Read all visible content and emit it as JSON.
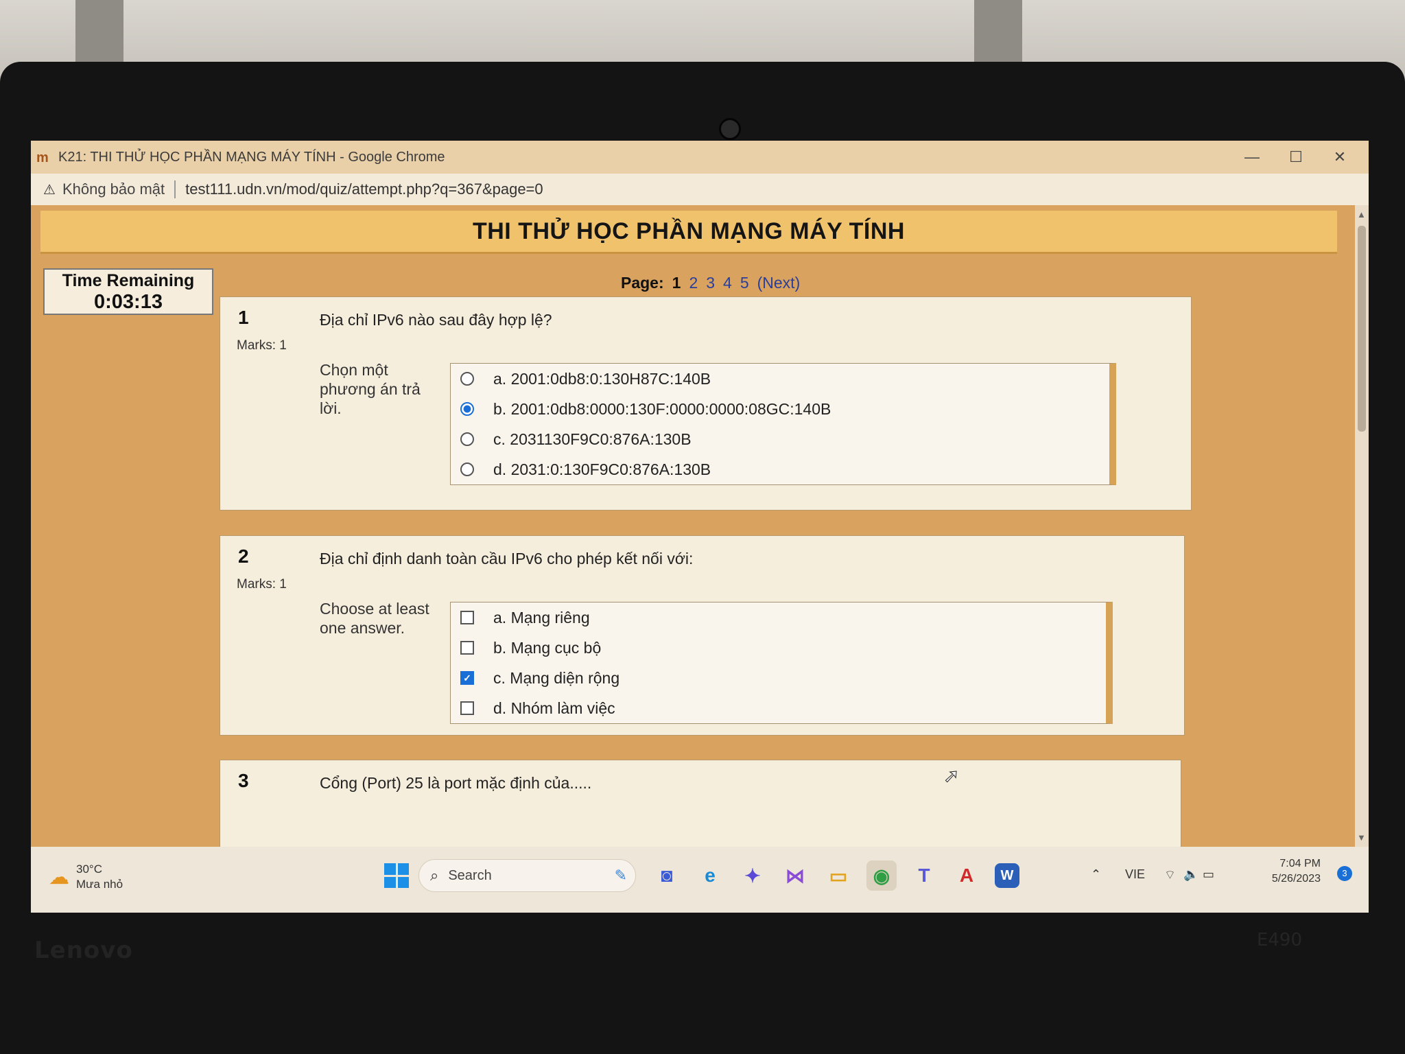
{
  "window": {
    "title": "K21: THI THỬ HỌC PHẦN MẠNG MÁY TÍNH - Google Chrome",
    "controls": {
      "minimize": "—",
      "maximize": "☐",
      "close": "✕"
    }
  },
  "address_bar": {
    "security_label": "Không bảo mật",
    "url": "test111.udn.vn/mod/quiz/attempt.php?q=367&page=0"
  },
  "page": {
    "title": "THI THỬ HỌC PHẦN MẠNG MÁY TÍNH",
    "timer": {
      "label": "Time Remaining",
      "value": "0:03:13"
    },
    "pagination": {
      "label": "Page:",
      "current": "1",
      "pages": [
        "2",
        "3",
        "4",
        "5"
      ],
      "next_label": "(Next)"
    }
  },
  "questions": [
    {
      "number": "1",
      "marks": "Marks: 1",
      "text": "Địa chỉ IPv6 nào sau đây hợp lệ?",
      "prompt": "Chọn một phương án trả lời.",
      "type": "radio",
      "answers": [
        {
          "label": "a. 2001:0db8:0:130H87C:140B",
          "selected": false
        },
        {
          "label": "b. 2001:0db8:0000:130F:0000:0000:08GC:140B",
          "selected": true
        },
        {
          "label": "c. 2031130F9C0:876A:130B",
          "selected": false
        },
        {
          "label": "d. 2031:0:130F9C0:876A:130B",
          "selected": false
        }
      ]
    },
    {
      "number": "2",
      "marks": "Marks: 1",
      "text": "Địa chỉ định danh toàn cầu IPv6 cho phép kết nối với:",
      "prompt": "Choose at least one answer.",
      "type": "checkbox",
      "answers": [
        {
          "label": "a. Mạng riêng",
          "selected": false
        },
        {
          "label": "b. Mạng cục bộ",
          "selected": false
        },
        {
          "label": "c. Mạng diện rộng",
          "selected": true
        },
        {
          "label": "d. Nhóm làm việc",
          "selected": false
        }
      ]
    },
    {
      "number": "3",
      "text": "Cổng (Port) 25 là port mặc định của....."
    }
  ],
  "taskbar": {
    "weather": {
      "temp": "30°C",
      "condition": "Mưa nhỏ"
    },
    "search_label": "Search",
    "language": "VIE",
    "time": "7:04 PM",
    "date": "5/26/2023",
    "notification_count": "3"
  },
  "device": {
    "brand": "Lenovo",
    "model": "E490"
  },
  "colors": {
    "page_background": "#d9a25f",
    "header_band": "#f0c26c",
    "question_bg": "#f6eedd",
    "accent_blue": "#1a6fd6",
    "link": "#2a3f9a"
  }
}
